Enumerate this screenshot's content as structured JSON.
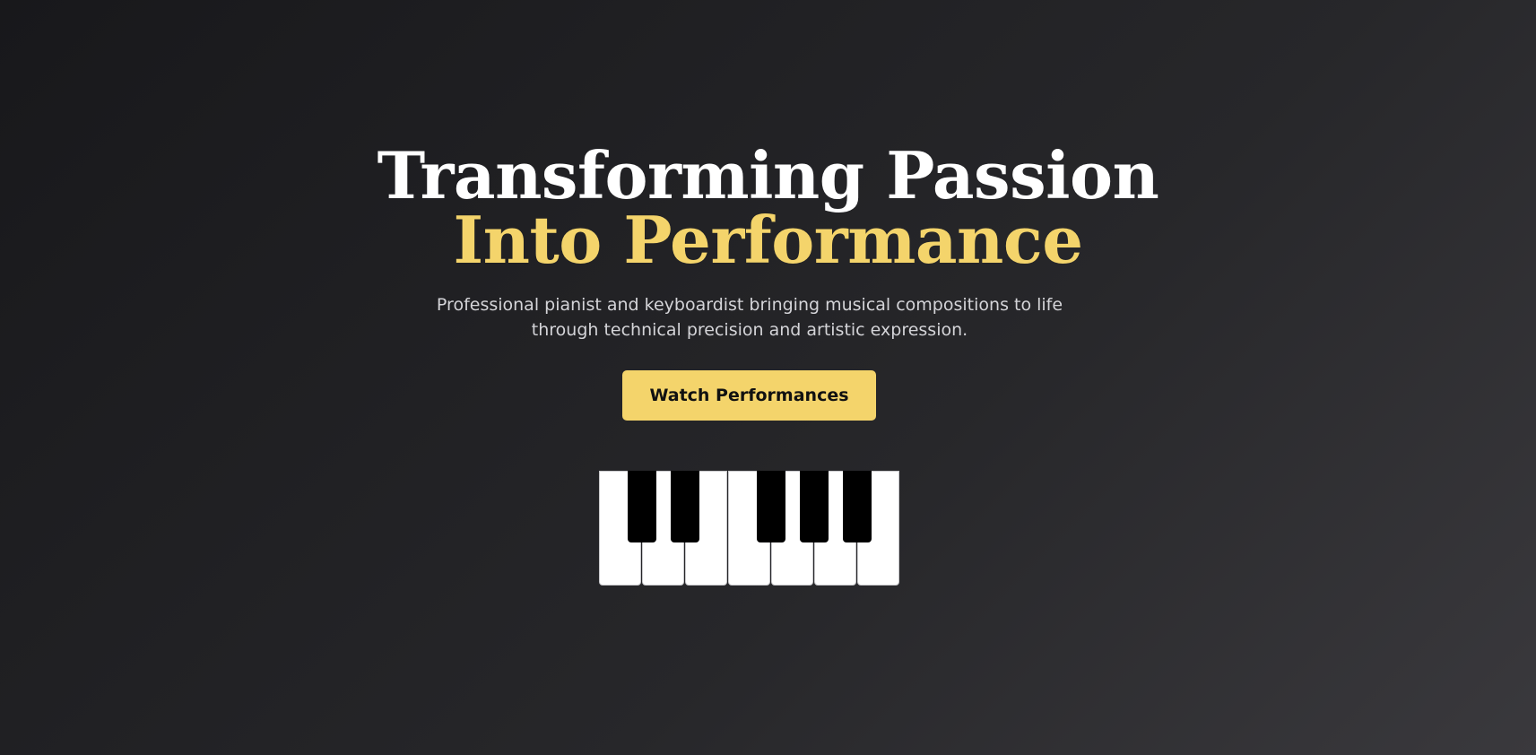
{
  "hero": {
    "title_line1": "Transforming Passion",
    "title_line2": "Into Performance",
    "subtitle_line1": "Professional pianist and keyboardist bringing musical compositions to life",
    "subtitle_line2": "through technical precision and artistic expression.",
    "cta_label": "Watch Performances"
  },
  "piano": {
    "white_keys": 7,
    "black_keys": 5
  },
  "colors": {
    "accent": "#f4d46b",
    "background_dark": "#18181b",
    "background_light": "#3a393d",
    "title": "#ffffff",
    "subtitle": "#d4d4d8"
  }
}
